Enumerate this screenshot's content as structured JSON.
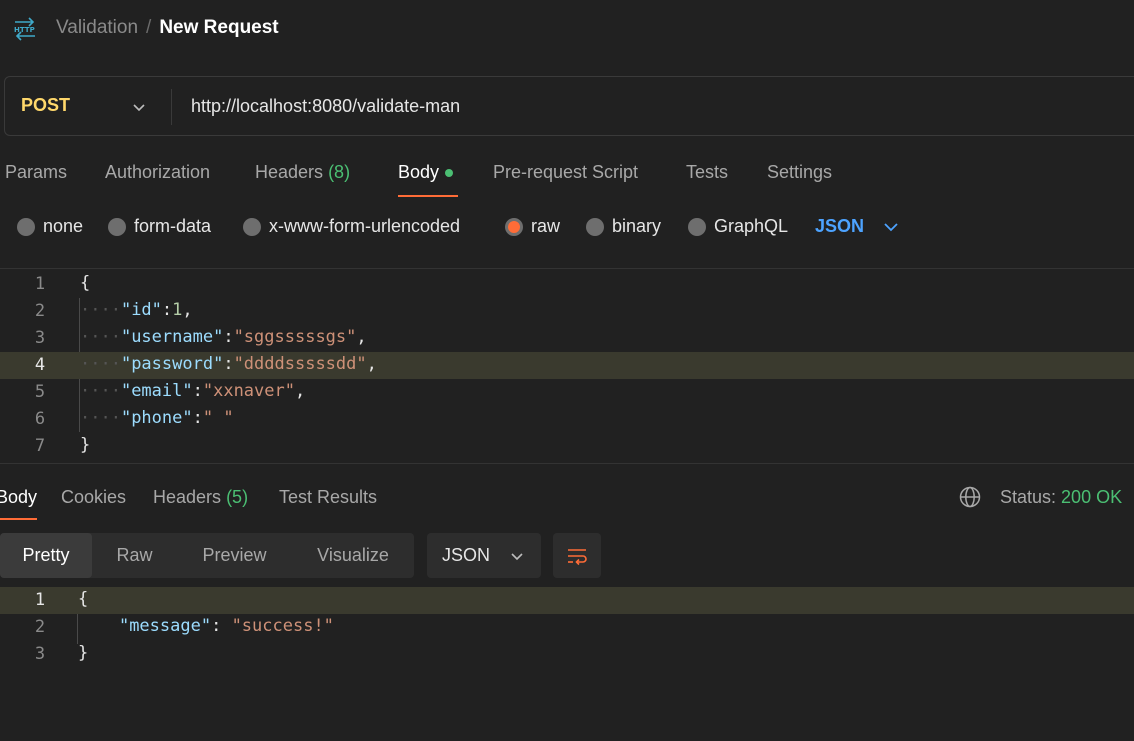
{
  "breadcrumb": {
    "parent": "Validation",
    "separator": "/",
    "current": "New Request"
  },
  "request": {
    "method": "POST",
    "url": "http://localhost:8080/validate-man"
  },
  "request_tabs": [
    {
      "label": "Params"
    },
    {
      "label": "Authorization"
    },
    {
      "label": "Headers",
      "count": "(8)"
    },
    {
      "label": "Body",
      "active": true
    },
    {
      "label": "Pre-request Script"
    },
    {
      "label": "Tests"
    },
    {
      "label": "Settings"
    }
  ],
  "body_types": [
    "none",
    "form-data",
    "x-www-form-urlencoded",
    "raw",
    "binary",
    "GraphQL"
  ],
  "body_type_selected": "raw",
  "body_format": "JSON",
  "request_body_lines": [
    {
      "n": "1",
      "open": "{"
    },
    {
      "n": "2",
      "key": "\"id\"",
      "num": "1",
      "tail": ","
    },
    {
      "n": "3",
      "key": "\"username\"",
      "str": "\"sggsssssgs\"",
      "tail": ","
    },
    {
      "n": "4",
      "key": "\"password\"",
      "str": "\"ddddsssssdd\"",
      "tail": ","
    },
    {
      "n": "5",
      "key": "\"email\"",
      "str": "\"xxnaver\"",
      "tail": ","
    },
    {
      "n": "6",
      "key": "\"phone\"",
      "str": "\" \""
    },
    {
      "n": "7",
      "close": "}"
    }
  ],
  "response_tabs": [
    {
      "label": "Body",
      "active": true
    },
    {
      "label": "Cookies"
    },
    {
      "label": "Headers",
      "count": "(5)"
    },
    {
      "label": "Test Results"
    }
  ],
  "status": {
    "label": "Status:",
    "value": "200 OK"
  },
  "response_views": [
    "Pretty",
    "Raw",
    "Preview",
    "Visualize"
  ],
  "response_view_selected": "Pretty",
  "response_format": "JSON",
  "response_body_lines": [
    {
      "n": "1",
      "text": "{"
    },
    {
      "n": "2",
      "key": "\"message\"",
      "str": "\"success!\""
    },
    {
      "n": "3",
      "text": "}"
    }
  ],
  "icons": {
    "http": "http-icon",
    "method_dropdown": "chevron-down-icon",
    "format_dropdown": "chevron-down-icon",
    "globe": "globe-icon",
    "wrap": "wrap-lines-icon"
  },
  "colors": {
    "background": "#212121",
    "accent": "#ff6c37",
    "method": "#ffd86b",
    "success": "#4bbf73",
    "json_link": "#4da3ff"
  }
}
